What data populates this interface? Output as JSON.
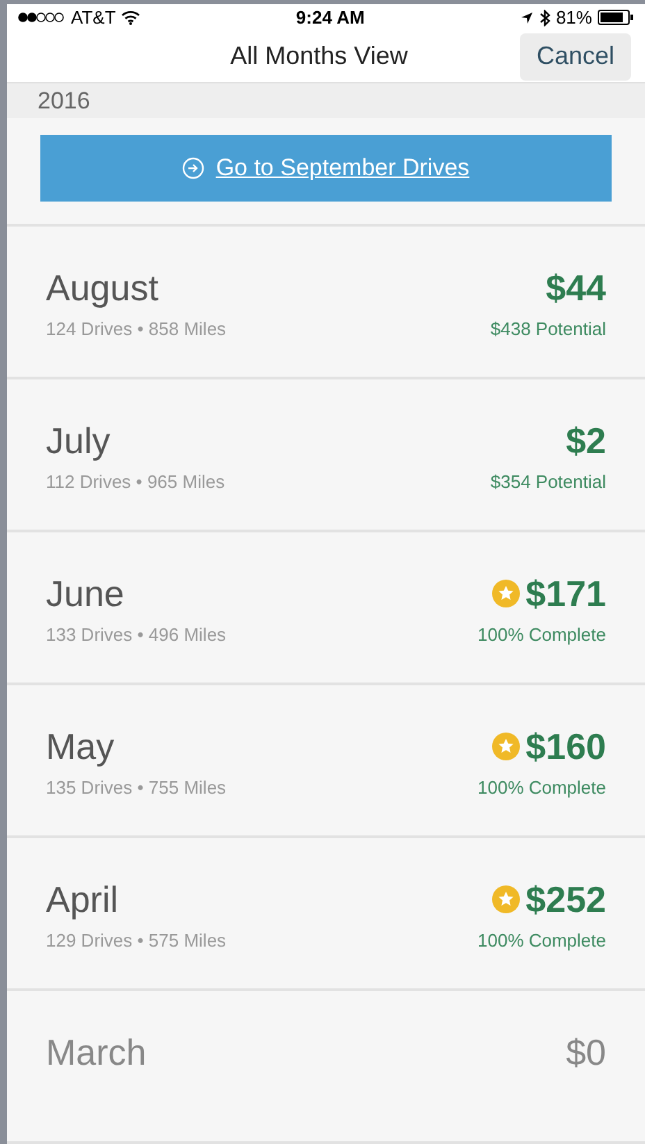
{
  "status_bar": {
    "carrier": "AT&T",
    "time": "9:24 AM",
    "battery": "81%"
  },
  "nav": {
    "title": "All Months View",
    "cancel": "Cancel"
  },
  "section": "2016",
  "goto_button": "Go to September Drives",
  "months": [
    {
      "name": "August",
      "details": "124 Drives • 858 Miles",
      "amount": "$44",
      "note": "$438 Potential",
      "kind": "earned",
      "starred": false
    },
    {
      "name": "July",
      "details": "112 Drives • 965 Miles",
      "amount": "$2",
      "note": "$354 Potential",
      "kind": "earned",
      "starred": false
    },
    {
      "name": "June",
      "details": "133 Drives • 496 Miles",
      "amount": "$171",
      "note": "100% Complete",
      "kind": "earned",
      "starred": true
    },
    {
      "name": "May",
      "details": "135 Drives • 755 Miles",
      "amount": "$160",
      "note": "100% Complete",
      "kind": "earned",
      "starred": true
    },
    {
      "name": "April",
      "details": "129 Drives • 575 Miles",
      "amount": "$252",
      "note": "100% Complete",
      "kind": "earned",
      "starred": true
    },
    {
      "name": "March",
      "amount": "$0",
      "kind": "inactive",
      "starred": false
    }
  ]
}
